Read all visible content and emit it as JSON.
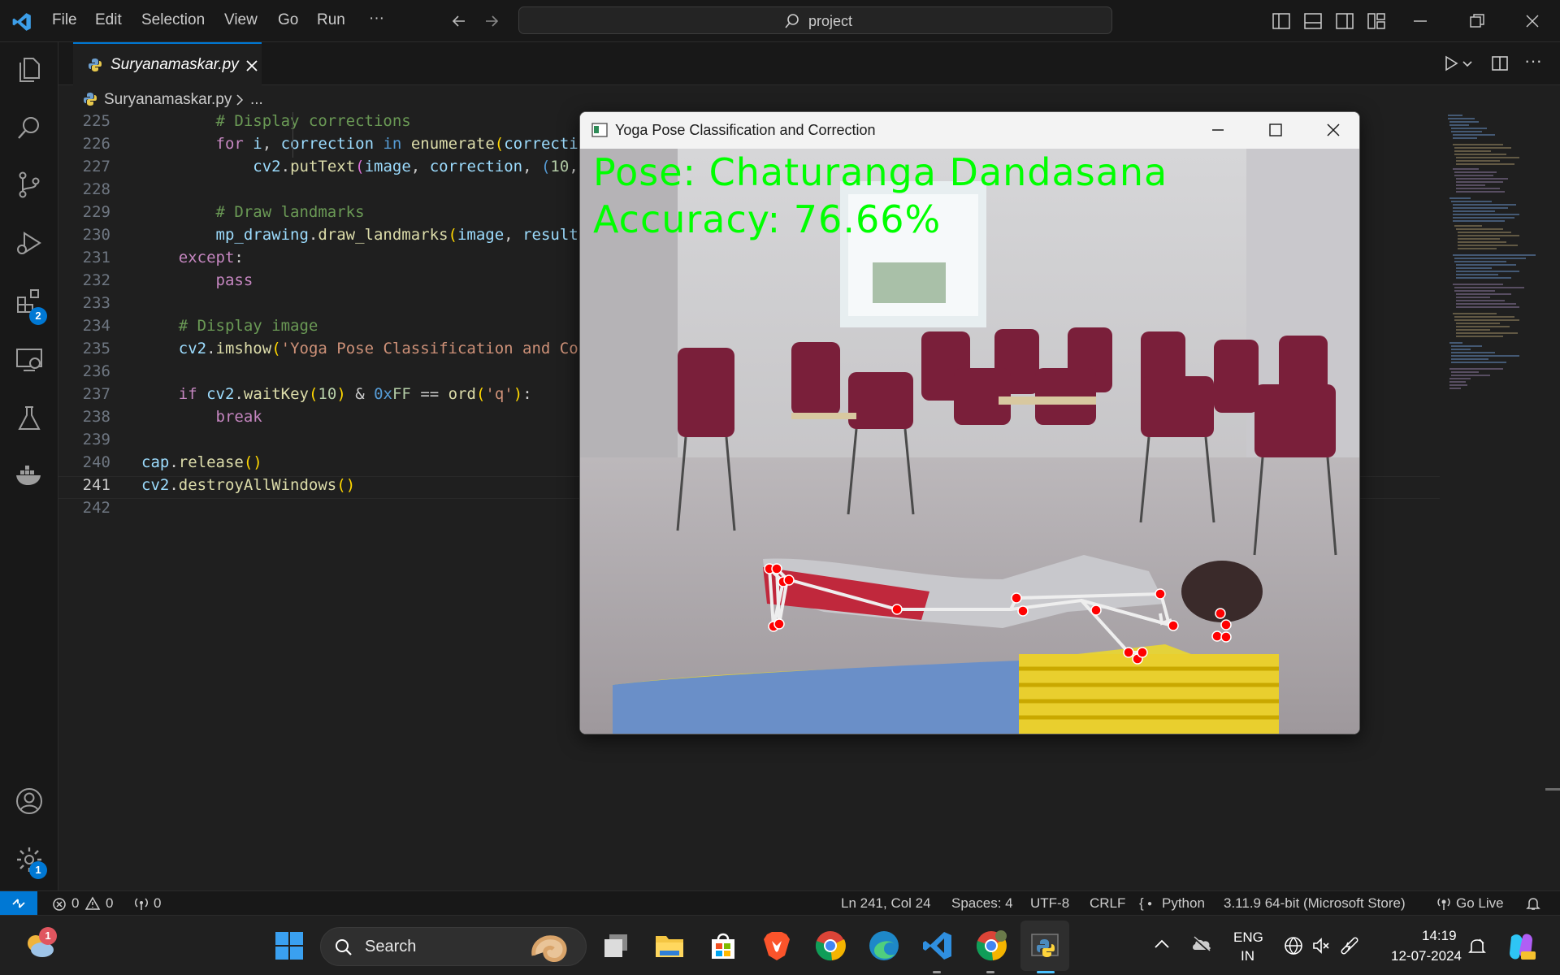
{
  "titlebar": {
    "menus": [
      "File",
      "Edit",
      "Selection",
      "View",
      "Go",
      "Run"
    ],
    "more": "···",
    "search_text": "project"
  },
  "tab": {
    "filename": "Suryanamaskar.py"
  },
  "breadcrumb": {
    "file": "Suryanamaskar.py",
    "rest": "..."
  },
  "activity": {
    "extensions_badge": "2",
    "settings_badge": "1"
  },
  "editor": {
    "lines": [
      {
        "n": "225",
        "text": "        # Display corrections"
      },
      {
        "n": "226",
        "text": "        for i, correction in enumerate(correcti"
      },
      {
        "n": "227",
        "text": "            cv2.putText(image, correction, (10,"
      },
      {
        "n": "228",
        "text": ""
      },
      {
        "n": "229",
        "text": "        # Draw landmarks"
      },
      {
        "n": "230",
        "text": "        mp_drawing.draw_landmarks(image, result"
      },
      {
        "n": "231",
        "text": "    except:"
      },
      {
        "n": "232",
        "text": "        pass"
      },
      {
        "n": "233",
        "text": ""
      },
      {
        "n": "234",
        "text": "    # Display image"
      },
      {
        "n": "235",
        "text": "    cv2.imshow('Yoga Pose Classification and Co"
      },
      {
        "n": "236",
        "text": ""
      },
      {
        "n": "237",
        "text": "    if cv2.waitKey(10) & 0xFF == ord('q'):"
      },
      {
        "n": "238",
        "text": "        break"
      },
      {
        "n": "239",
        "text": ""
      },
      {
        "n": "240",
        "text": "cap.release()"
      },
      {
        "n": "241",
        "text": "cv2.destroyAllWindows()"
      },
      {
        "n": "242",
        "text": ""
      }
    ],
    "current_line": "241"
  },
  "cv_window": {
    "title": "Yoga Pose Classification and Correction",
    "pose_label": "Pose: Chaturanga Dandasana",
    "accuracy_label": "Accuracy: 76.66%",
    "overlay_color": "#00ff00",
    "landmark_color": "#ff0000"
  },
  "statusbar": {
    "errors": "0",
    "warnings": "0",
    "ports": "0",
    "position": "Ln 241, Col 24",
    "spaces": "Spaces: 4",
    "encoding": "UTF-8",
    "eol": "CRLF",
    "language": "Python",
    "interpreter": "3.11.9 64-bit (Microsoft Store)",
    "golive": "Go Live"
  },
  "taskbar": {
    "search_label": "Search",
    "lang_top": "ENG",
    "lang_bottom": "IN",
    "time": "14:19",
    "date": "12-07-2024",
    "weather_badge": "1"
  },
  "colors": {
    "accent": "#0078d4",
    "editor_bg": "#1f1f1f",
    "chrome_bg": "#181818"
  }
}
